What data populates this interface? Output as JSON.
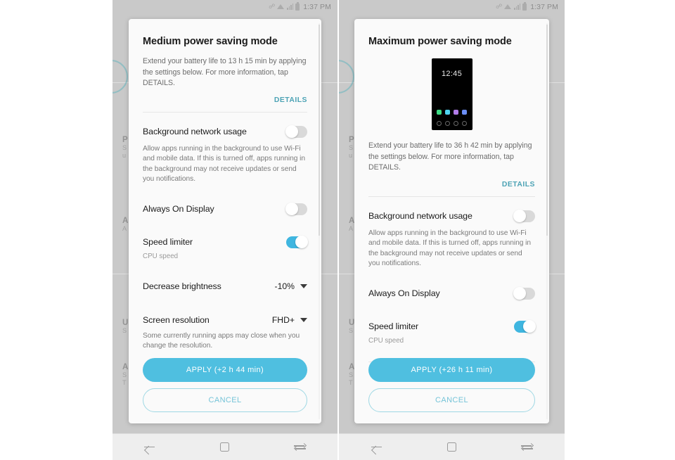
{
  "statusbar": {
    "time": "1:37 PM",
    "icons": [
      "bluetooth-icon",
      "wifi-icon",
      "signal-icon",
      "battery-icon"
    ]
  },
  "navbar": {
    "back_label": "back-icon",
    "home_label": "home-icon",
    "recents_label": "recents-icon"
  },
  "background_settings": {
    "rows": [
      {
        "title": "P",
        "sub1": "S",
        "sub2": "u"
      },
      {
        "title": "A",
        "sub1": "A",
        "sub2": ""
      },
      {
        "title": "U",
        "sub1": "S",
        "sub2": ""
      },
      {
        "title": "A",
        "sub1": "S",
        "sub2": "T"
      }
    ]
  },
  "left_phone": {
    "dialog": {
      "title": "Medium power saving mode",
      "description": "Extend your battery life to 13 h 15 min by applying the settings below. For more information, tap DETAILS.",
      "details_label": "DETAILS",
      "settings": [
        {
          "label": "Background network usage",
          "description": "Allow apps running in the background to use Wi-Fi and mobile data. If this is turned off, apps running in the background may not receive updates or send you notifications.",
          "control": "toggle",
          "state": "off"
        },
        {
          "label": "Always On Display",
          "control": "toggle",
          "state": "off"
        },
        {
          "label": "Speed limiter",
          "sub": "CPU speed",
          "control": "toggle",
          "state": "on"
        },
        {
          "label": "Decrease brightness",
          "control": "dropdown",
          "value": "-10%"
        },
        {
          "label": "Screen resolution",
          "control": "dropdown",
          "value": "FHD+",
          "description": "Some currently running apps may close when you change the resolution."
        }
      ],
      "apply_label": "APPLY (+2 h 44 min)",
      "cancel_label": "CANCEL"
    }
  },
  "right_phone": {
    "dialog": {
      "title": "Maximum power saving mode",
      "preview": {
        "time": "12:45",
        "app_colors": [
          "#3ddc84",
          "#4fd4f0",
          "#b07ce8",
          "#6b8ef5"
        ],
        "empty_slots": 4
      },
      "description": "Extend your battery life to 36 h 42 min by applying the settings below. For more information, tap DETAILS.",
      "details_label": "DETAILS",
      "settings": [
        {
          "label": "Background network usage",
          "description": "Allow apps running in the background to use Wi-Fi and mobile data. If this is turned off, apps running in the background may not receive updates or send you notifications.",
          "control": "toggle",
          "state": "off"
        },
        {
          "label": "Always On Display",
          "control": "toggle",
          "state": "off"
        },
        {
          "label": "Speed limiter",
          "sub": "CPU speed",
          "control": "toggle",
          "state": "on"
        }
      ],
      "apply_label": "APPLY (+26 h 11 min)",
      "cancel_label": "CANCEL"
    }
  },
  "colors": {
    "accent": "#4fbfe0",
    "toggle_on": "#3fb6e0",
    "details_link": "#4da3b5",
    "phone_bg": "#c9c9c9",
    "dialog_bg": "#fafafa"
  }
}
